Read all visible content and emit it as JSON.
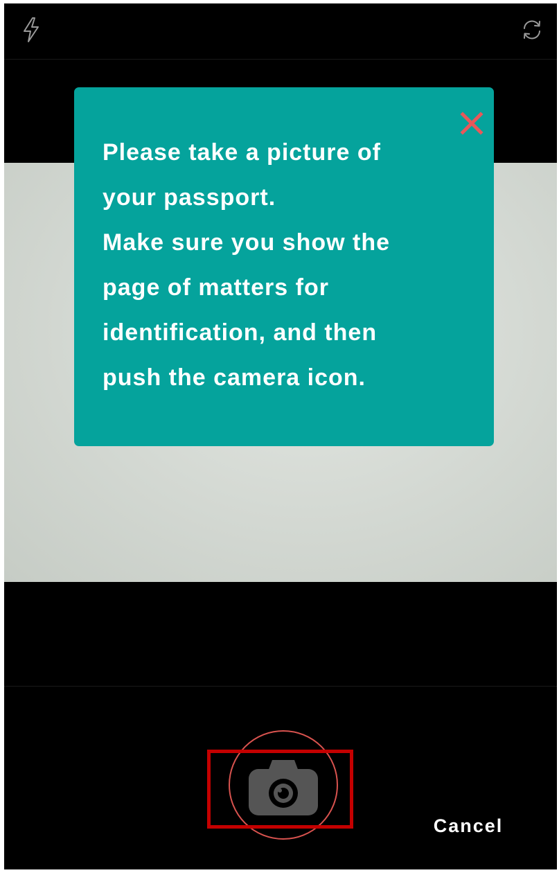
{
  "topbar": {
    "flash_icon": "flash-icon",
    "switch_camera_icon": "switch-camera-icon"
  },
  "modal": {
    "close_icon": "close-icon",
    "lines": [
      "Please take a picture of",
      "your passport.",
      "Make sure you show the",
      "page of matters for",
      "identification, and then",
      "push the camera icon."
    ]
  },
  "bottombar": {
    "shutter_icon": "camera-icon",
    "cancel_label": "Cancel"
  },
  "colors": {
    "modal_background": "#05a39c",
    "close_icon": "#e8585a",
    "shutter_ring": "#d9534f",
    "highlight_box": "#c40000",
    "camera_icon": "#555555"
  }
}
